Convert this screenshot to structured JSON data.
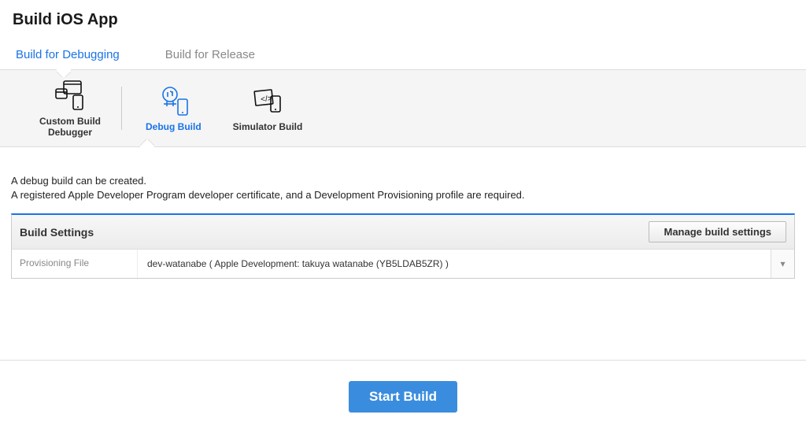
{
  "page": {
    "title": "Build iOS App"
  },
  "tabs": [
    {
      "label": "Build for Debugging",
      "active": true
    },
    {
      "label": "Build for Release",
      "active": false
    }
  ],
  "build_options": [
    {
      "label": "Custom Build\nDebugger",
      "icon": "custom-build-icon",
      "active": false
    },
    {
      "label": "Debug Build",
      "icon": "debug-build-icon",
      "active": true
    },
    {
      "label": "Simulator Build",
      "icon": "simulator-build-icon",
      "active": false
    }
  ],
  "description": {
    "line1": "A debug build can be created.",
    "line2": "A registered Apple Developer Program developer certificate, and a Development Provisioning profile are required."
  },
  "settings": {
    "header_title": "Build Settings",
    "manage_label": "Manage build settings",
    "rows": [
      {
        "label": "Provisioning File",
        "value": "dev-watanabe  ( Apple Development: takuya watanabe (YB5LDAB5ZR) )"
      }
    ]
  },
  "footer": {
    "start_label": "Start Build"
  },
  "colors": {
    "accent": "#1a73e8",
    "primary_button": "#3a8dde"
  }
}
